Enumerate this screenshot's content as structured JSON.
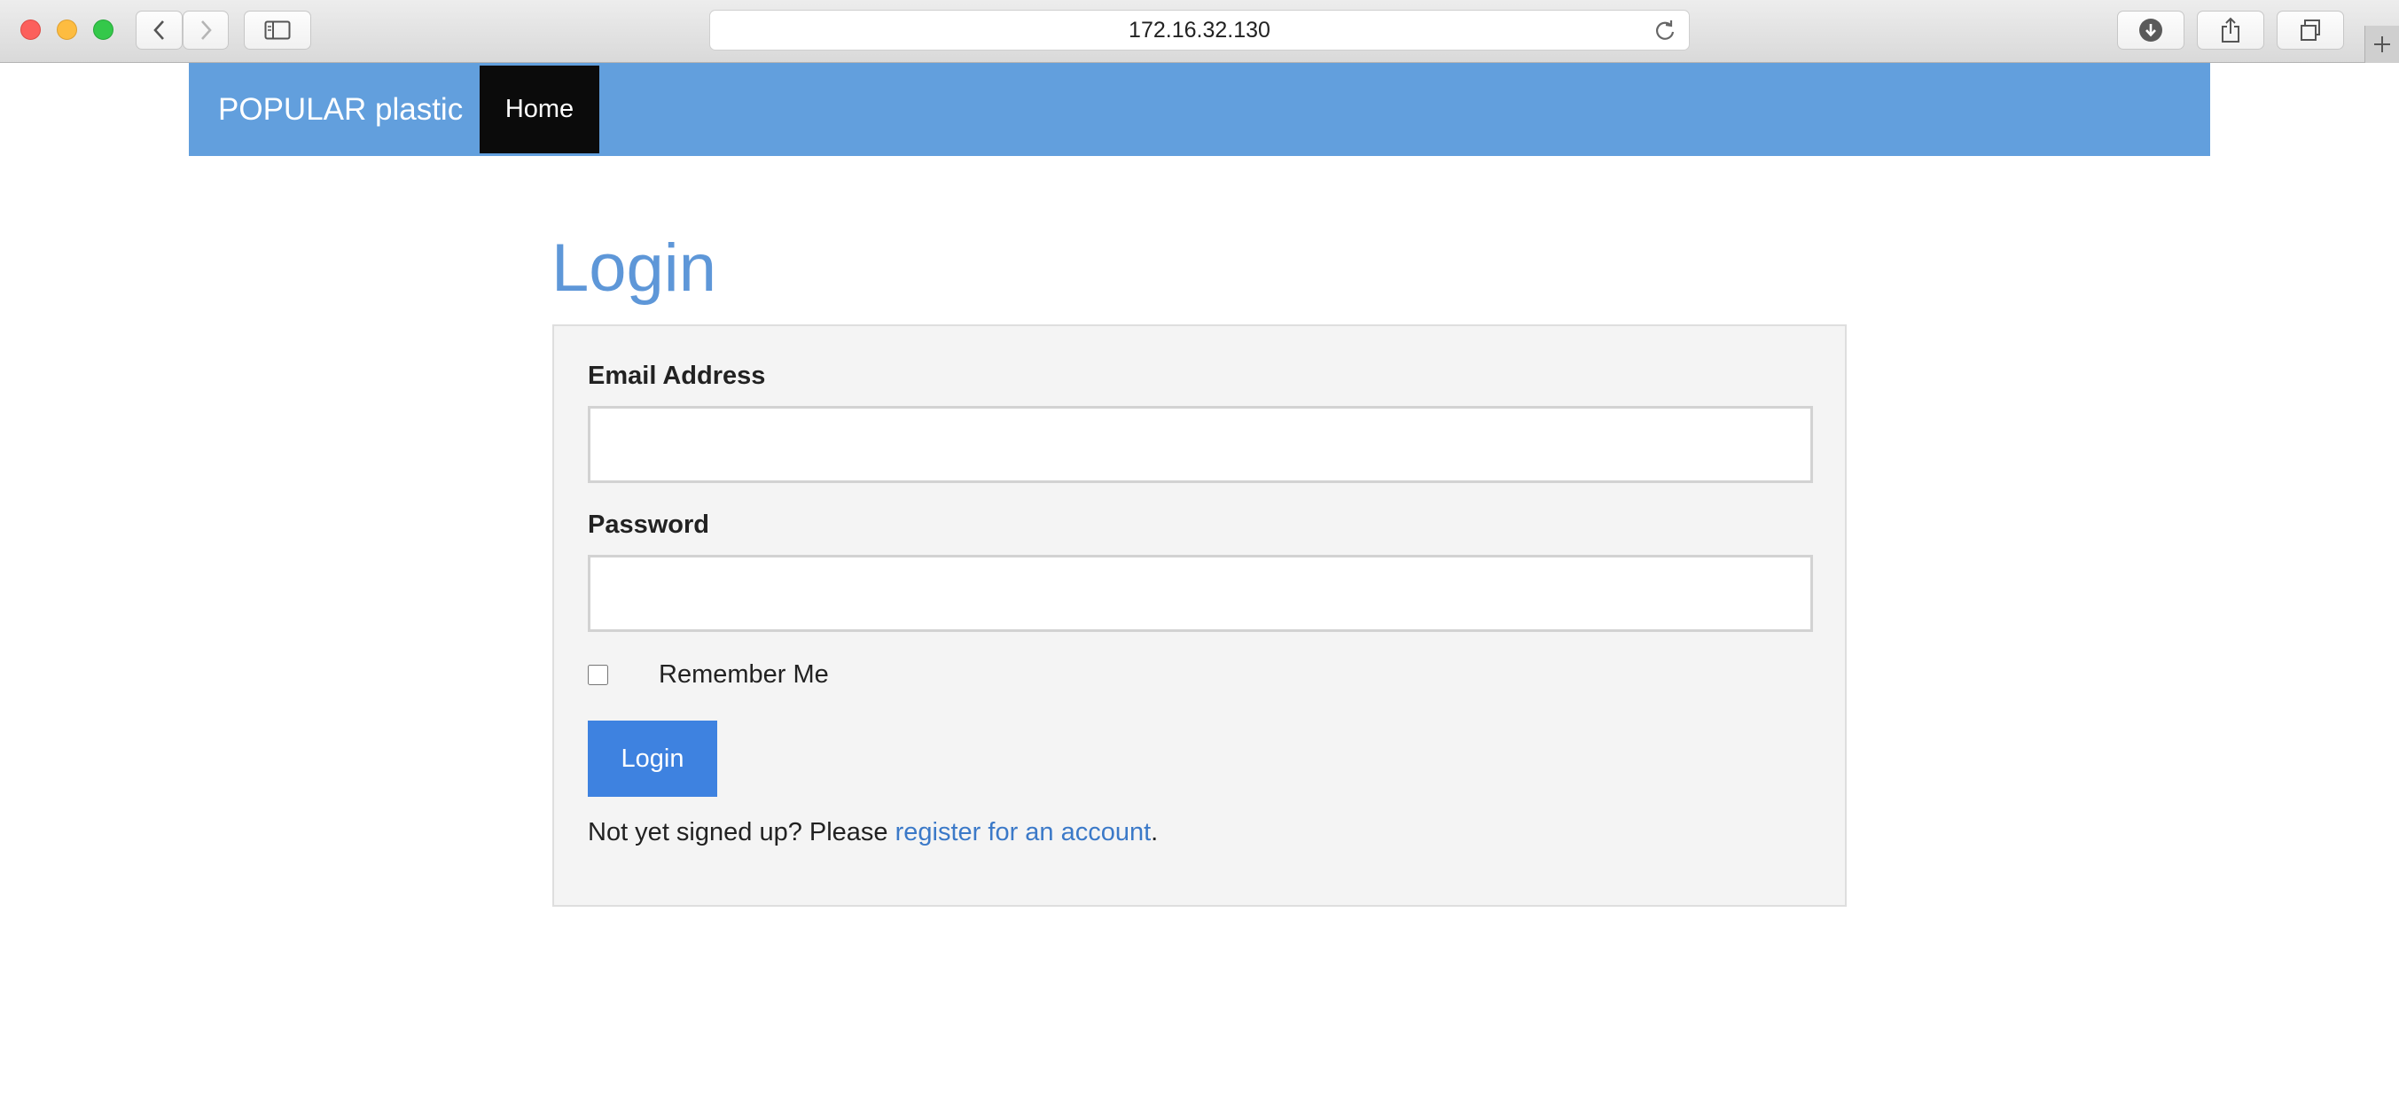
{
  "browser": {
    "url": "172.16.32.130"
  },
  "navbar": {
    "brand": "POPULAR plastic",
    "home_label": "Home",
    "color": "#629fdd"
  },
  "login": {
    "title": "Login",
    "email_label": "Email Address",
    "email_value": "",
    "password_label": "Password",
    "password_value": "",
    "remember_label": "Remember Me",
    "remember_checked": false,
    "submit_label": "Login",
    "signup_prefix": "Not yet signed up? Please ",
    "signup_link": "register for an account",
    "signup_suffix": "."
  },
  "colors": {
    "accent": "#3e82e0",
    "title": "#5e97d8",
    "link": "#3b79c8",
    "active_nav": "#0b0b0b"
  },
  "icons": [
    "back-icon",
    "forward-icon",
    "sidebar-icon",
    "reload-icon",
    "download-icon",
    "share-icon",
    "tabs-icon",
    "plus-icon"
  ]
}
